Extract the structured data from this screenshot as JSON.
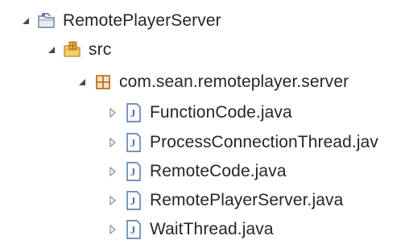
{
  "tree": {
    "project": {
      "label": "RemotePlayerServer",
      "icon": "java-project-icon",
      "expanded": true
    },
    "source_folder": {
      "label": "src",
      "icon": "source-folder-icon",
      "expanded": true
    },
    "package": {
      "label": "com.sean.remoteplayer.server",
      "icon": "package-icon",
      "expanded": true
    },
    "files": [
      {
        "label": "FunctionCode.java",
        "icon": "java-file-icon"
      },
      {
        "label": "ProcessConnectionThread.jav",
        "icon": "java-file-icon"
      },
      {
        "label": "RemoteCode.java",
        "icon": "java-file-icon"
      },
      {
        "label": "RemotePlayerServer.java",
        "icon": "java-file-icon"
      },
      {
        "label": "WaitThread.java",
        "icon": "java-file-icon"
      }
    ]
  },
  "colors": {
    "text": "#262626",
    "arrow": "#5a5a5a",
    "package": "#b5631d",
    "folder": "#e6b34a",
    "java_file": "#4a6fa8"
  }
}
